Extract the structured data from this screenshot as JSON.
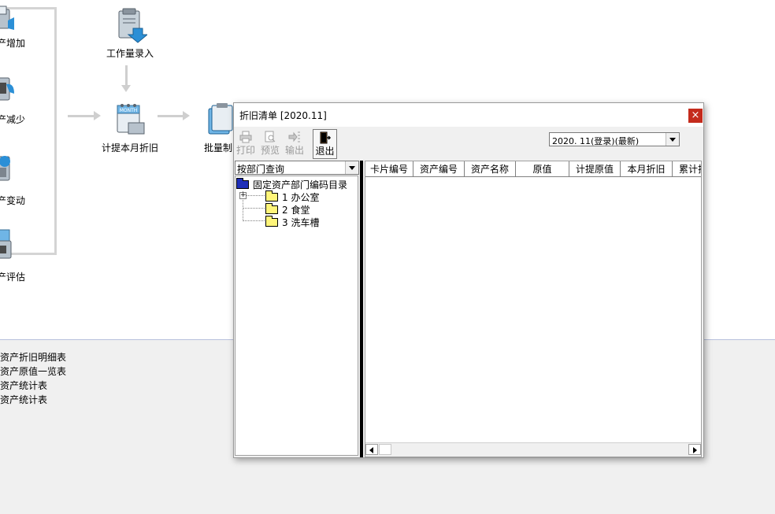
{
  "flow": {
    "left_nodes": [
      {
        "label": "产增加"
      },
      {
        "label": "产减少"
      },
      {
        "label": "产变动"
      },
      {
        "label": "产评估"
      }
    ],
    "workload_entry": "工作量录入",
    "monthly_depreciation": "计提本月折旧",
    "batch_make": "批量制"
  },
  "reports": [
    "资产折旧明细表",
    "资产原值一览表",
    "资产统计表",
    "资产统计表"
  ],
  "dialog": {
    "title": "折旧清单 [2020.11]",
    "close_glyph": "×",
    "toolbar": {
      "print": "打印",
      "preview": "预览",
      "export": "输出",
      "exit": "退出"
    },
    "period": "2020. 11(登录)(最新)",
    "query_mode": "按部门查询",
    "tree": {
      "root": "固定资产部门编码目录",
      "items": [
        {
          "code": "1",
          "name": "办公室"
        },
        {
          "code": "2",
          "name": "食堂"
        },
        {
          "code": "3",
          "name": "洗车槽"
        }
      ]
    },
    "columns": [
      "卡片编号",
      "资产编号",
      "资产名称",
      "原值",
      "计提原值",
      "本月折旧",
      "累计折"
    ]
  },
  "colors": {
    "close_button": "#c42b1c",
    "root_folder": "#1f2fb8",
    "folder": "#fff57a"
  }
}
